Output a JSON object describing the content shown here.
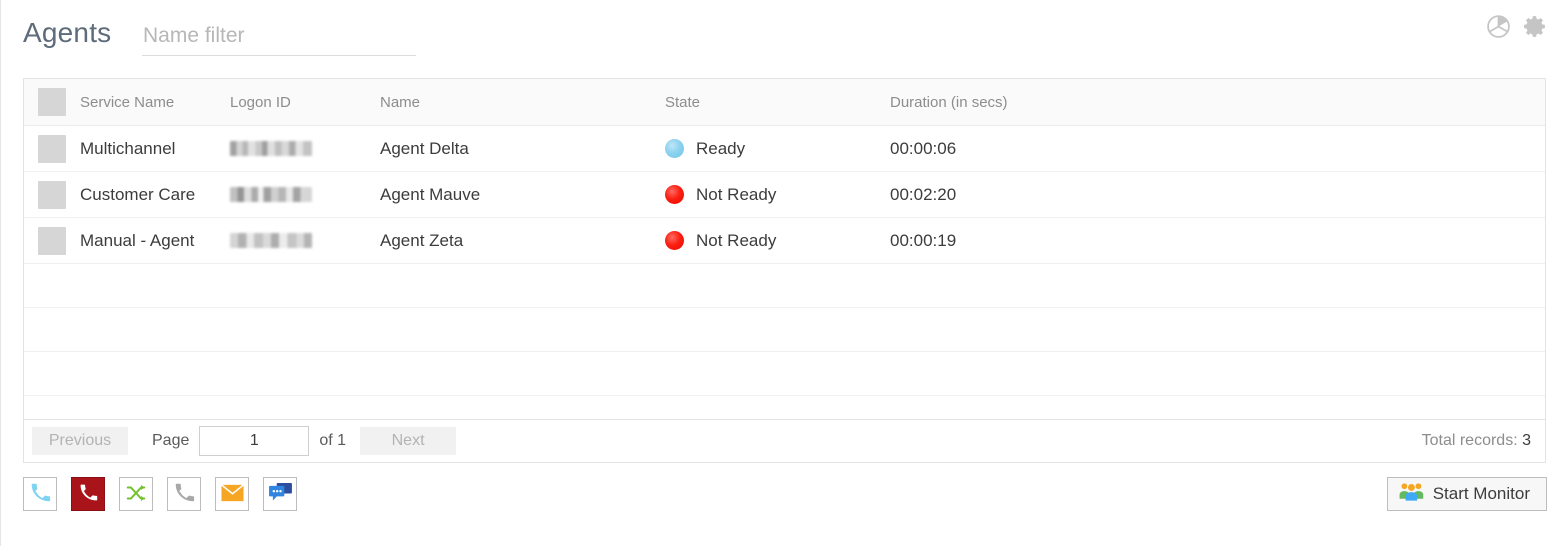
{
  "header": {
    "title": "Agents",
    "filter_placeholder": "Name filter",
    "filter_value": "",
    "icons": [
      {
        "name": "pie-chart-icon",
        "color": "#c8c8c8"
      },
      {
        "name": "gear-icon",
        "color": "#c8c8c8"
      }
    ]
  },
  "table": {
    "columns": [
      {
        "key": "check",
        "label": ""
      },
      {
        "key": "service",
        "label": "Service Name"
      },
      {
        "key": "logon",
        "label": "Logon ID"
      },
      {
        "key": "name",
        "label": "Name"
      },
      {
        "key": "state",
        "label": "State"
      },
      {
        "key": "dur",
        "label": "Duration (in secs)"
      }
    ],
    "rows": [
      {
        "service": "Multichannel",
        "logon": "",
        "name": "Agent Delta",
        "state": "Ready",
        "state_kind": "ready",
        "state_color": "#8fd3ef",
        "duration": "00:00:06"
      },
      {
        "service": "Customer Care",
        "logon": "",
        "name": "Agent Mauve",
        "state": "Not Ready",
        "state_kind": "notready",
        "state_color": "#fb1f12",
        "duration": "00:02:20"
      },
      {
        "service": "Manual - Agent",
        "logon": "",
        "name": "Agent Zeta",
        "state": "Not Ready",
        "state_kind": "notready",
        "state_color": "#fb1f12",
        "duration": "00:00:19"
      }
    ],
    "empty_row_count": 3
  },
  "pager": {
    "previous_label": "Previous",
    "page_label": "Page",
    "page_value": "1",
    "of_label": "of 1",
    "next_label": "Next",
    "total_label": "Total records:",
    "total_value": "3"
  },
  "toolbar": {
    "buttons": [
      {
        "name": "answer-call-button",
        "icon": "phone-icon",
        "color": "#7fd3f2",
        "style": "outline"
      },
      {
        "name": "end-call-button",
        "icon": "phone-icon",
        "color": "#ffffff",
        "style": "filled-red"
      },
      {
        "name": "transfer-call-button",
        "icon": "shuffle-icon",
        "color": "#72c02c",
        "style": "outline"
      },
      {
        "name": "hold-call-button",
        "icon": "phone-icon",
        "color": "#a8a8a8",
        "style": "outline"
      },
      {
        "name": "email-button",
        "icon": "envelope-icon",
        "color": "#f5a623",
        "style": "outline"
      },
      {
        "name": "chat-button",
        "icon": "chat-bubbles-icon",
        "color": "#2f73c9",
        "style": "outline"
      }
    ]
  },
  "monitor": {
    "label": "Start Monitor",
    "icon": "people-group-icon"
  }
}
